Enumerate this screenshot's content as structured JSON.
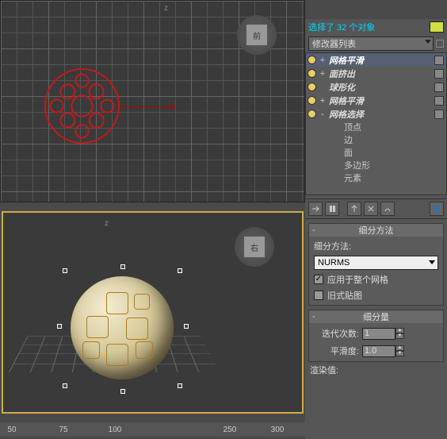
{
  "toolbar": {
    "icons": [
      "curve-tool",
      "globe-icon",
      "material-icon",
      "hierarchy-icon",
      "motion-icon",
      "display-icon",
      "utilities-icon",
      "hammer-icon"
    ]
  },
  "selection": {
    "text": "选择了 32 个对象"
  },
  "modifier_list": {
    "label": "修改器列表"
  },
  "stack": {
    "items": [
      {
        "label": "网格平滑",
        "expand": "+",
        "checked": false,
        "sel": true
      },
      {
        "label": "面挤出",
        "expand": "+",
        "checked": false,
        "sel": false
      },
      {
        "label": "球形化",
        "expand": "",
        "checked": false,
        "sel": false
      },
      {
        "label": "网格平滑",
        "expand": "+",
        "checked": false,
        "sel": false
      },
      {
        "label": "网格选择",
        "expand": "-",
        "checked": false,
        "sel": false
      }
    ],
    "subitems": [
      "顶点",
      "边",
      "面",
      "多边形",
      "元素"
    ]
  },
  "toolrow_icons": [
    "pin-stack-icon",
    "show-end-icon",
    "make-unique-icon",
    "remove-mod-icon",
    "configure-icon"
  ],
  "rollout1": {
    "title": "细分方法",
    "method_label": "细分方法:",
    "combo_value": "NURMS",
    "chk1_label": "应用于整个网格",
    "chk1_checked": true,
    "chk2_label": "旧式贴图",
    "chk2_checked": false
  },
  "rollout2": {
    "title": "细分量",
    "iter_label": "迭代次数:",
    "iter_value": "1",
    "smooth_label": "平滑度:",
    "smooth_value": "1.0"
  },
  "footer": {
    "render_label": "渲染值:"
  },
  "viewcube": {
    "top_label": "前",
    "bot_label": "右"
  },
  "ruler": {
    "ticks": [
      {
        "pos": 15,
        "label": "50"
      },
      {
        "pos": 80,
        "label": "75"
      },
      {
        "pos": 145,
        "label": "100"
      },
      {
        "pos": 210,
        "label": " "
      },
      {
        "pos": 290,
        "label": "250"
      },
      {
        "pos": 350,
        "label": "300"
      }
    ]
  }
}
